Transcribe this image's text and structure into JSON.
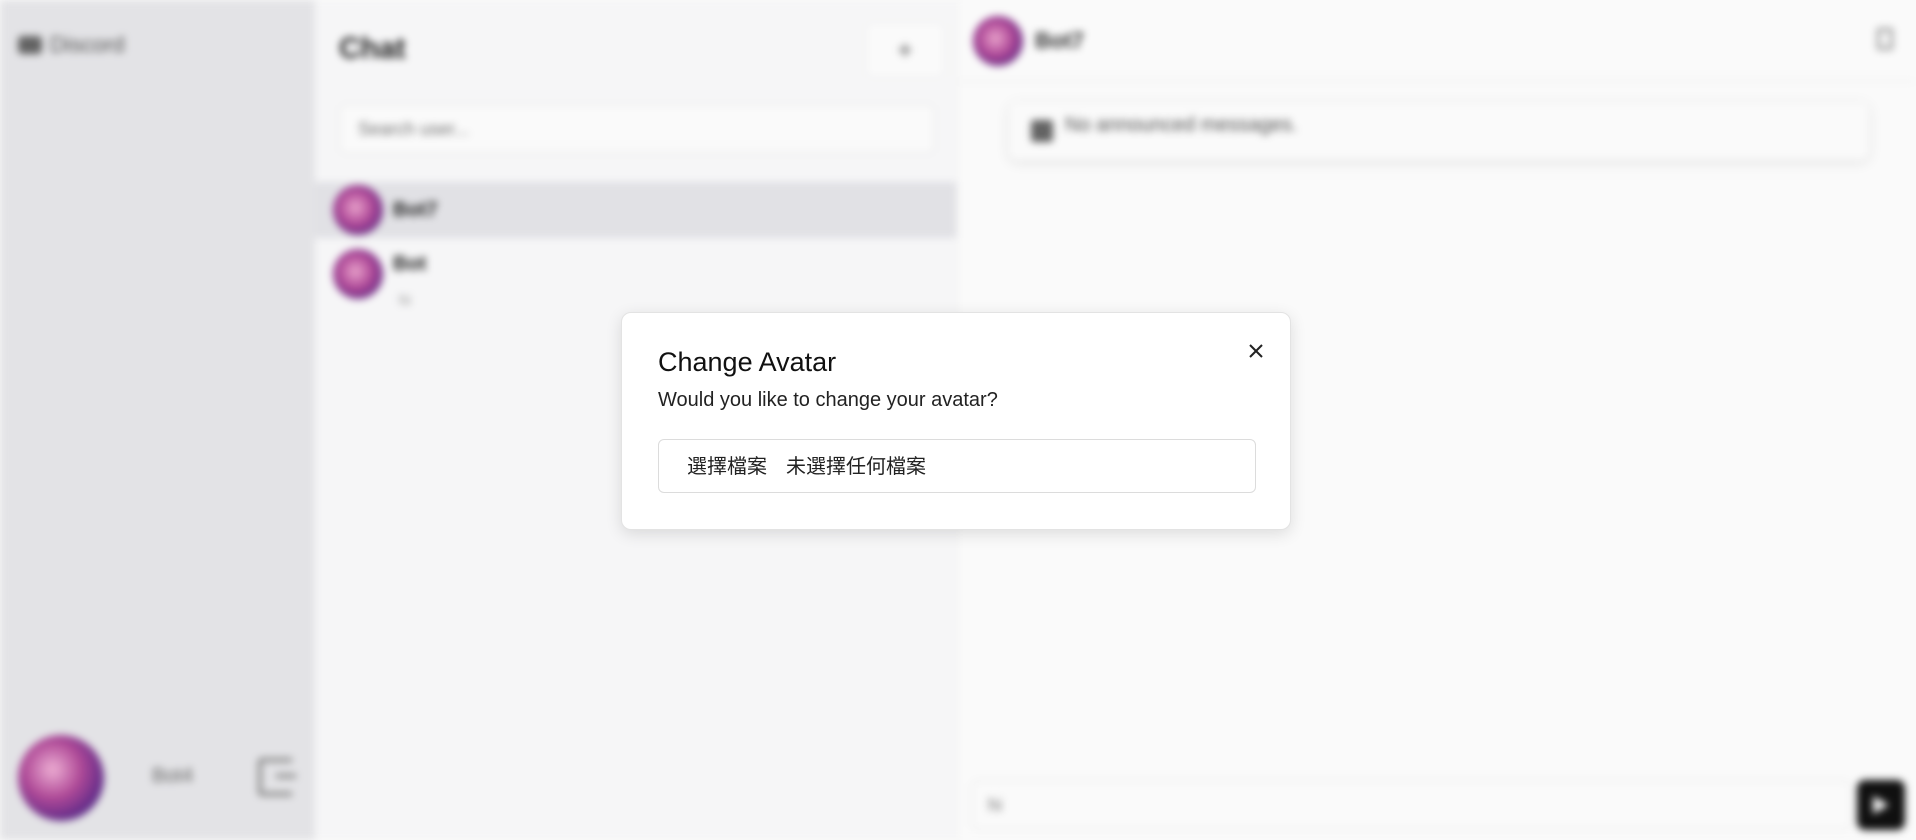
{
  "sidebar": {
    "brand": "Discord",
    "user_name": "Bot4"
  },
  "chat_list": {
    "title": "Chat",
    "add_label": "+",
    "search_placeholder": "Search user...",
    "items": [
      {
        "name": "Bot7",
        "subtitle": ""
      },
      {
        "name": "Bot",
        "subtitle": "hi"
      }
    ]
  },
  "conversation": {
    "name": "Bot7",
    "announcement": "No announced messages.",
    "composer_text": "hi"
  },
  "modal": {
    "title": "Change Avatar",
    "description": "Would you like to change your avatar?",
    "file_button_label": "選擇檔案",
    "file_status": "未選擇任何檔案"
  }
}
